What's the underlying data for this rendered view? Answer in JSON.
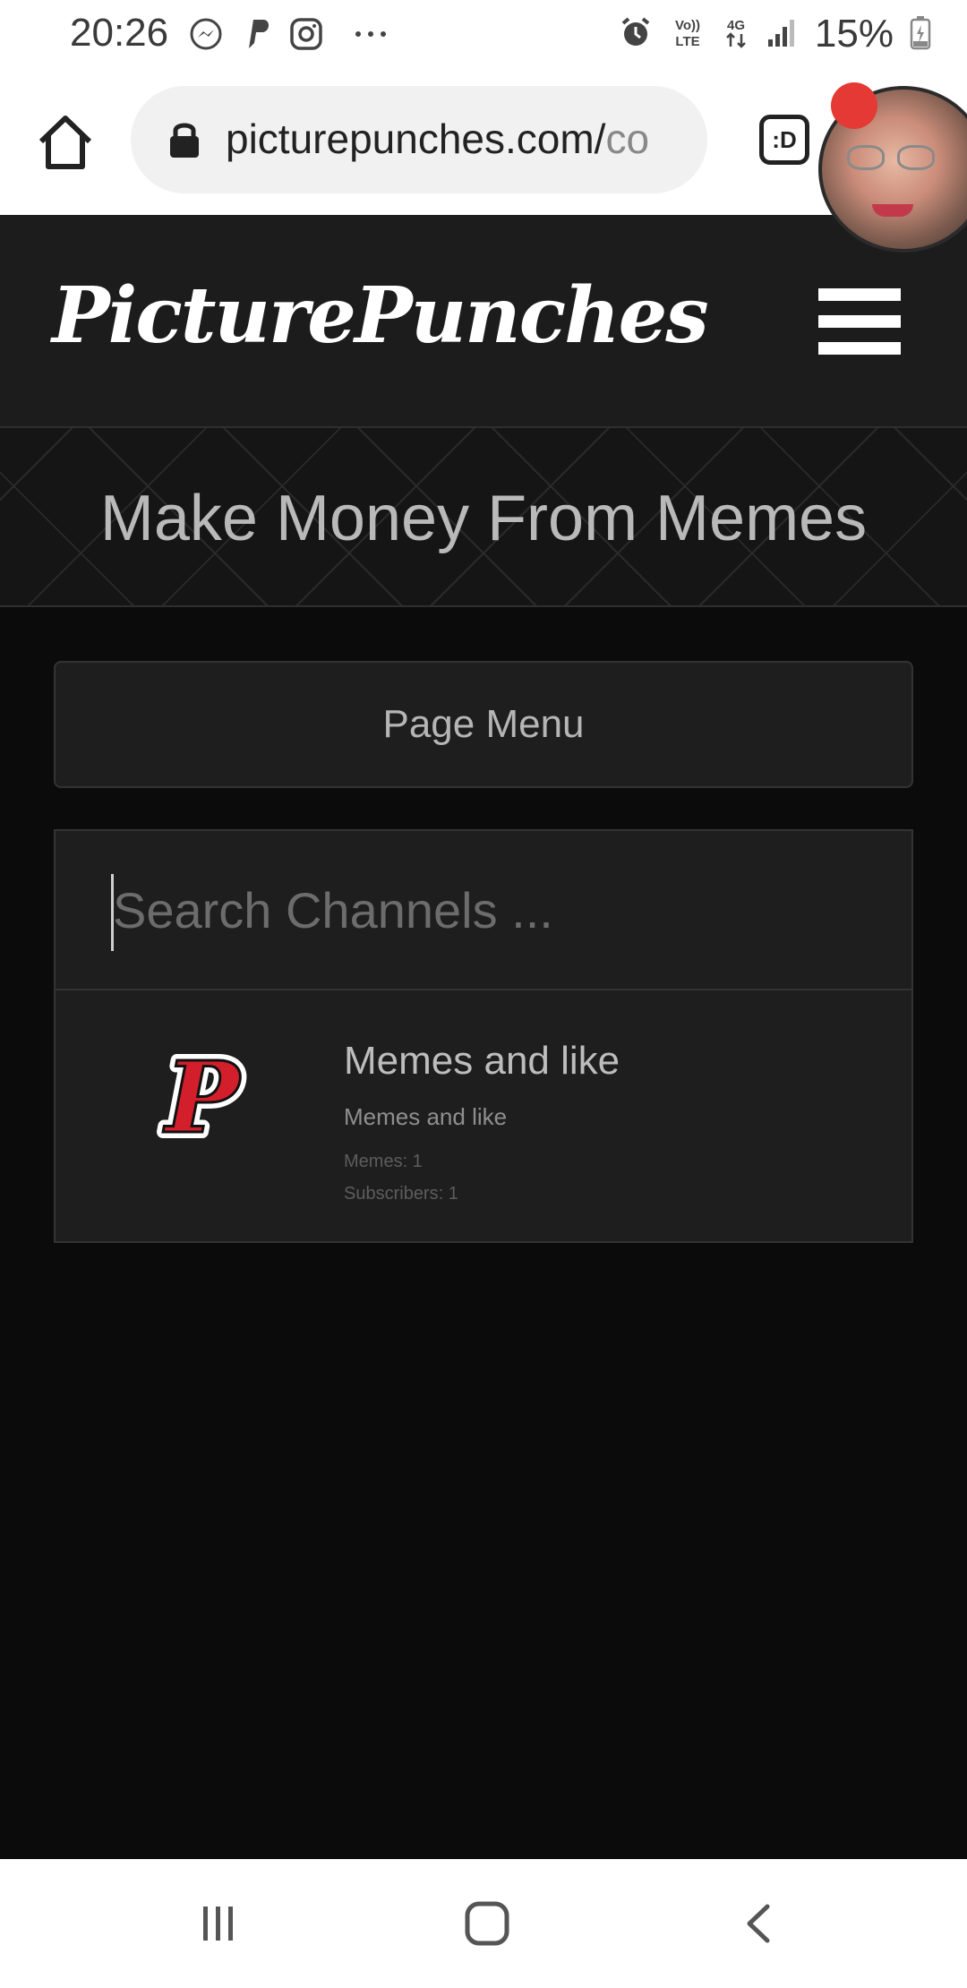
{
  "status_bar": {
    "time": "20:26",
    "notification_icons": [
      "messenger-icon",
      "paypal-icon",
      "instagram-icon",
      "more-dots-icon"
    ],
    "system_icons": [
      "alarm-icon",
      "volte-icon",
      "4g-icon",
      "signal-icon",
      "battery-icon"
    ],
    "battery": "15%"
  },
  "browser": {
    "url_main": "picturepunches.com/",
    "url_fade": "co",
    "tab_label": ":D"
  },
  "site": {
    "logo_text": "PicturePunches",
    "banner_title": "Make Money From Memes",
    "page_menu_label": "Page Menu",
    "search_placeholder": "Search Channels ...",
    "channels": [
      {
        "title": "Memes and like",
        "subtitle": "Memes and like",
        "memes": "Memes: 1",
        "subscribers": "Subscribers: 1"
      }
    ]
  },
  "colors": {
    "page_bg": "#0b0b0b",
    "header_bg": "#1c1c1c",
    "card_bg": "#1e1e1e",
    "logo_red": "#d21f2b"
  },
  "nav_bar": {
    "buttons": [
      "recent-apps-icon",
      "home-icon",
      "back-icon"
    ]
  }
}
